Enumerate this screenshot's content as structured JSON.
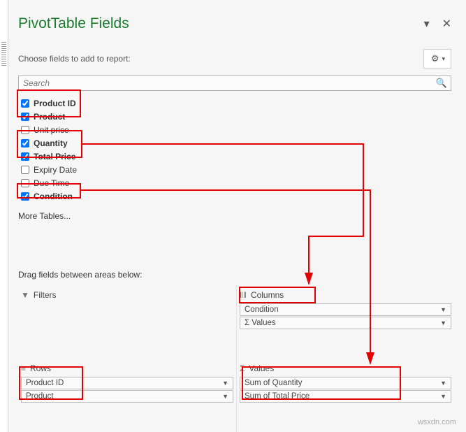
{
  "header": {
    "title": "PivotTable Fields",
    "collapse_glyph": "▾",
    "close_glyph": "✕",
    "subtext": "Choose fields to add to report:",
    "gear_glyph": "⚙",
    "gear_drop": "▾"
  },
  "search": {
    "placeholder": "Search",
    "mag_glyph": "🔍"
  },
  "fields": [
    {
      "label": "Product ID",
      "checked": true
    },
    {
      "label": "Product",
      "checked": true
    },
    {
      "label": "Unit price",
      "checked": false
    },
    {
      "label": "Quantity",
      "checked": true
    },
    {
      "label": "Total Price",
      "checked": true
    },
    {
      "label": "Expiry Date",
      "checked": false
    },
    {
      "label": "Due Time",
      "checked": false
    },
    {
      "label": "Condition",
      "checked": true
    }
  ],
  "more_tables": "More Tables...",
  "areas_caption": "Drag fields between areas below:",
  "areas": {
    "filters": {
      "title": "Filters",
      "icon": "▾",
      "items": []
    },
    "columns": {
      "title": "Columns",
      "icon": "‖‖",
      "items": [
        "Condition",
        "Σ  Values"
      ]
    },
    "rows": {
      "title": "Rows",
      "icon": "≡",
      "items": [
        "Product ID",
        "Product"
      ]
    },
    "values": {
      "title": "Values",
      "icon": "Σ",
      "items": [
        "Sum of Quantity",
        "Sum of Total Price"
      ]
    }
  },
  "watermark": "wsxdn.com",
  "drop_glyph": "▼"
}
